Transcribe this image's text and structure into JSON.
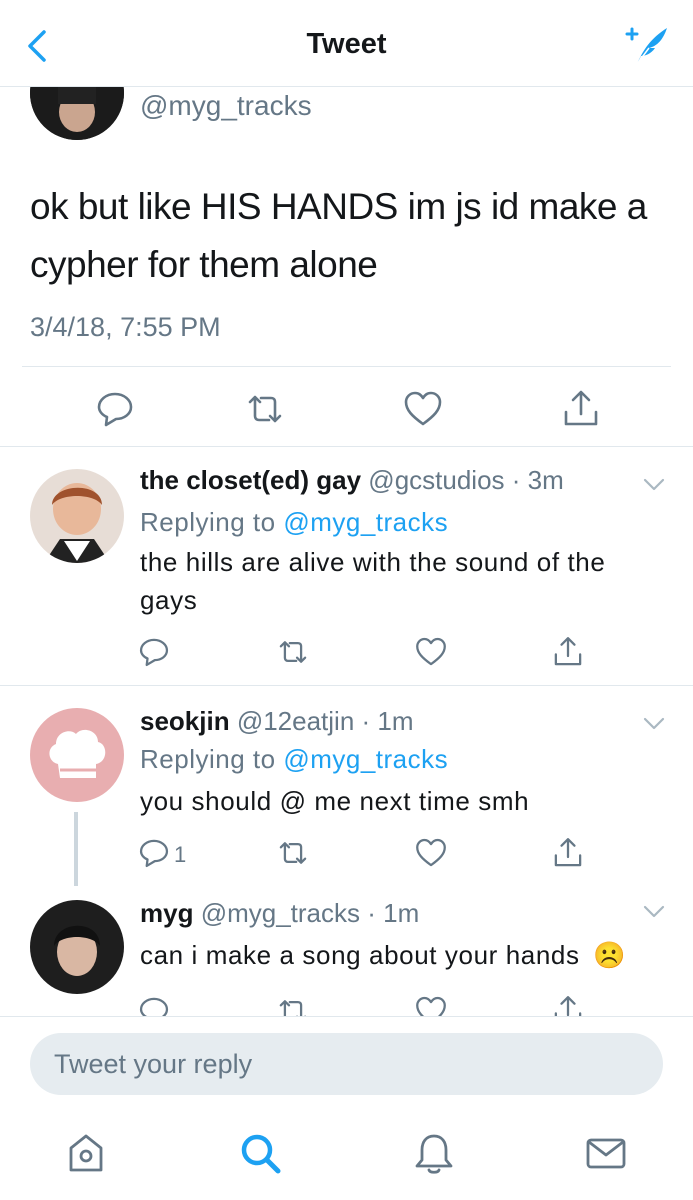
{
  "header": {
    "title": "Tweet"
  },
  "main_tweet": {
    "handle": "@myg_tracks",
    "text": "ok but like HIS HANDS im js id make a cypher for them alone",
    "timestamp": "3/4/18, 7:55 PM"
  },
  "replies": [
    {
      "name": "the closet(ed) gay",
      "handle": "@gcstudios",
      "time": "· 3m",
      "replying_prefix": "Replying to",
      "replying_to": "@myg_tracks",
      "text": "the hills are alive with the sound of the gays"
    },
    {
      "name": "seokjin",
      "handle": "@12eatjin",
      "time": "· 1m",
      "replying_prefix": "Replying to",
      "replying_to": "@myg_tracks",
      "text": "you should @ me next time smh",
      "reply_count": "1"
    },
    {
      "name": "myg",
      "handle": "@myg_tracks",
      "time": "· 1m",
      "text": "can i make a song about your hands",
      "emoji": "☹️"
    }
  ],
  "reply_box": {
    "placeholder": "Tweet your reply"
  },
  "tabs": [
    "home-icon",
    "search-icon",
    "notifications-icon",
    "messages-icon"
  ],
  "colors": {
    "accent": "#1da1f2",
    "secondary_text": "#657786",
    "border": "#e1e8ed",
    "icon": "#657786"
  }
}
